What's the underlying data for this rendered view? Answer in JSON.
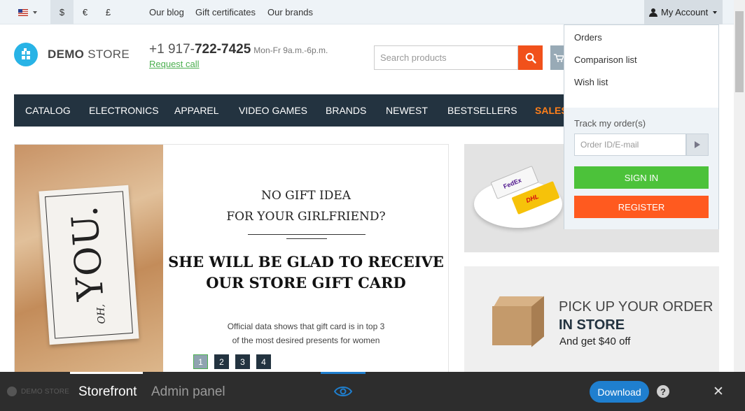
{
  "topbar": {
    "currencies": [
      "$",
      "€",
      "£"
    ],
    "links": [
      "Our blog",
      "Gift certificates",
      "Our brands"
    ],
    "account_label": "My Account"
  },
  "header": {
    "logo_bold": "DEMO",
    "logo_light": " STORE",
    "phone_prefix": "+1 917-",
    "phone_main": "722-7425",
    "hours": "Mon-Fr 9a.m.-6p.m.",
    "request_call": "Request call",
    "search_placeholder": "Search products"
  },
  "nav": {
    "items": [
      "CATALOG",
      "ELECTRONICS",
      "APPAREL",
      "VIDEO GAMES",
      "BRANDS",
      "NEWEST",
      "BESTSELLERS",
      "SALES"
    ]
  },
  "banner": {
    "card_oh": "OH,",
    "card_you": "YOU.",
    "line1": "NO GIFT IDEA",
    "line2": "FOR YOUR GIRLFRIEND?",
    "headline1": "SHE WILL BE GLAD TO RECEIVE",
    "headline2": "OUR STORE GIFT CARD",
    "small1": "Official data shows that gift card is in top 3",
    "small2": "of the most desired presents for women",
    "pages": [
      "1",
      "2",
      "3",
      "4"
    ]
  },
  "promo_delivery": {
    "fedex_label": "FedEx",
    "dhl_label": "DHL"
  },
  "promo_pickup": {
    "line1": "PICK UP YOUR ORDER",
    "line2": "IN STORE",
    "line3": "And get $40 off"
  },
  "account_dropdown": {
    "items": [
      "Orders",
      "Comparison list",
      "Wish list"
    ],
    "track_label": "Track my order(s)",
    "track_placeholder": "Order ID/E-mail",
    "sign_in": "SIGN IN",
    "register": "REGISTER"
  },
  "demobar": {
    "logo_text": "DEMO STORE",
    "tab_storefront": "Storefront",
    "tab_admin": "Admin panel",
    "download": "Download",
    "help": "?",
    "close": "✕"
  },
  "colors": {
    "nav_bg": "#233340",
    "accent_orange": "#f1511b",
    "sales_orange": "#ff7f1a",
    "green": "#4cc23a",
    "blue": "#1f7fcf",
    "logo_blue": "#28b3e6"
  },
  "icons": [
    "flag-us-icon",
    "user-icon",
    "search-icon",
    "cart-icon",
    "play-arrow-icon",
    "eye-icon",
    "help-icon",
    "close-icon"
  ]
}
